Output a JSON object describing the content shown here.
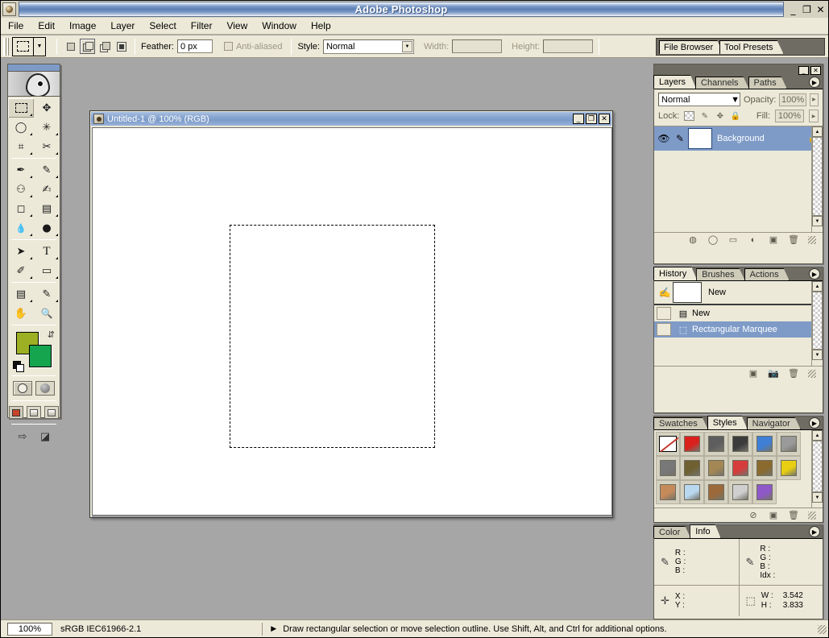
{
  "window": {
    "title": "Adobe Photoshop",
    "controls": {
      "minimize": "_",
      "maximize": "❐",
      "close": "✕"
    }
  },
  "menubar": {
    "items": [
      {
        "label": "File"
      },
      {
        "label": "Edit"
      },
      {
        "label": "Image"
      },
      {
        "label": "Layer"
      },
      {
        "label": "Select"
      },
      {
        "label": "Filter"
      },
      {
        "label": "View"
      },
      {
        "label": "Window"
      },
      {
        "label": "Help"
      }
    ]
  },
  "options_bar": {
    "tool": "rectangular-marquee",
    "selection_modes": [
      "new-selection",
      "add-to-selection",
      "subtract-from-selection",
      "intersect-with-selection"
    ],
    "active_selection_mode_index": 1,
    "feather_label": "Feather:",
    "feather_value": "0 px",
    "antialias_label": "Anti-aliased",
    "antialias_checked": false,
    "style_label": "Style:",
    "style_value": "Normal",
    "width_label": "Width:",
    "width_value": "",
    "height_label": "Height:",
    "height_value": "",
    "palette_well": [
      {
        "label": "File Browser"
      },
      {
        "label": "Tool Presets"
      }
    ]
  },
  "toolbox": {
    "foreground_color": "#9db023",
    "background_color": "#15a54f",
    "selected_tool": "rectangular-marquee",
    "tools": [
      {
        "name": "rectangular-marquee",
        "glyph": "",
        "selected": true
      },
      {
        "name": "move",
        "glyph": "✥"
      },
      {
        "name": "lasso",
        "glyph": "◯"
      },
      {
        "name": "magic-wand",
        "glyph": "✳"
      },
      {
        "name": "crop",
        "glyph": "⌗"
      },
      {
        "name": "slice",
        "glyph": "✂"
      },
      {
        "name": "healing-brush",
        "glyph": "✒"
      },
      {
        "name": "brush",
        "glyph": "✎"
      },
      {
        "name": "clone-stamp",
        "glyph": "⚇"
      },
      {
        "name": "history-brush",
        "glyph": "✍"
      },
      {
        "name": "eraser",
        "glyph": "◻"
      },
      {
        "name": "gradient",
        "glyph": "▤"
      },
      {
        "name": "blur",
        "glyph": "💧"
      },
      {
        "name": "dodge",
        "glyph": "●"
      },
      {
        "name": "path-selection",
        "glyph": "➤"
      },
      {
        "name": "type",
        "glyph": "T"
      },
      {
        "name": "pen",
        "glyph": "✐"
      },
      {
        "name": "rectangle-shape",
        "glyph": "▭"
      },
      {
        "name": "notes",
        "glyph": "▤"
      },
      {
        "name": "eyedropper",
        "glyph": "✎"
      },
      {
        "name": "hand",
        "glyph": "✋"
      },
      {
        "name": "zoom",
        "glyph": "🔍"
      }
    ],
    "screen_modes": [
      "standard-screen-mode",
      "full-screen-with-menu-bar",
      "full-screen-mode"
    ],
    "active_screen_mode_index": 0,
    "mask_modes": [
      "standard-mask-mode",
      "quick-mask-mode"
    ],
    "jump_to": [
      "jump-to-imageready",
      "preview-in-browser"
    ]
  },
  "document": {
    "title": "Untitled-1 @ 100% (RGB)",
    "controls": {
      "minimize": "_",
      "maximize": "❐",
      "close": "✕"
    },
    "selection": {
      "type": "rectangular-marquee",
      "visible": true
    }
  },
  "layers_panel": {
    "tabs": [
      {
        "label": "Layers",
        "active": true
      },
      {
        "label": "Channels",
        "active": false
      },
      {
        "label": "Paths",
        "active": false
      }
    ],
    "blend_mode": "Normal",
    "opacity_label": "Opacity:",
    "opacity_value": "100%",
    "lock_label": "Lock:",
    "lock_icons": [
      "lock-transparent-pixels",
      "lock-image-pixels",
      "lock-position",
      "lock-all"
    ],
    "fill_label": "Fill:",
    "fill_value": "100%",
    "layers": [
      {
        "name": "Background",
        "visible": true,
        "locked": true,
        "selected": true
      }
    ],
    "footer_icons": [
      "layer-style",
      "layer-mask",
      "layer-group",
      "adjustment-layer",
      "new-layer",
      "delete-layer"
    ]
  },
  "history_panel": {
    "tabs": [
      {
        "label": "History",
        "active": true
      },
      {
        "label": "Brushes",
        "active": false
      },
      {
        "label": "Actions",
        "active": false
      }
    ],
    "snapshot": {
      "label": "New"
    },
    "states": [
      {
        "label": "New",
        "icon": "new-document-icon",
        "selected": false
      },
      {
        "label": "Rectangular Marquee",
        "icon": "marquee-icon",
        "selected": true
      }
    ],
    "footer_icons": [
      "create-document-from-state",
      "create-new-snapshot",
      "delete-state"
    ]
  },
  "styles_panel": {
    "tabs": [
      {
        "label": "Swatches",
        "active": false
      },
      {
        "label": "Styles",
        "active": true
      },
      {
        "label": "Navigator",
        "active": false
      }
    ],
    "styles": [
      {
        "name": "default-none",
        "color": "none"
      },
      {
        "name": "sunspot",
        "color": "#d9201c"
      },
      {
        "name": "gray-button",
        "color": "#5e5e5e"
      },
      {
        "name": "dark-metal",
        "color": "#3b3b3b"
      },
      {
        "name": "blue-glass",
        "color": "#3f7fd6"
      },
      {
        "name": "flat-gray",
        "color": "#9a9a9a"
      },
      {
        "name": "gray-gradient",
        "color": "#787878"
      },
      {
        "name": "olive-brown",
        "color": "#6f6032"
      },
      {
        "name": "tan-texture",
        "color": "#a38754"
      },
      {
        "name": "red-stripes",
        "color": "#d63c3c"
      },
      {
        "name": "rainbow-swirl",
        "color": "#8a6a2d"
      },
      {
        "name": "yellow-gold",
        "color": "#e8cf12"
      },
      {
        "name": "sunset-gradient",
        "color": "#c58a5a"
      },
      {
        "name": "light-blue",
        "color": "#b9d8f0"
      },
      {
        "name": "beach-scene",
        "color": "#9c6a3a"
      },
      {
        "name": "noise-texture",
        "color": "#cfcfcf"
      },
      {
        "name": "purple-gradient",
        "color": "#8e58c8"
      }
    ],
    "footer_icons": [
      "clear-style",
      "new-style",
      "delete-style"
    ]
  },
  "info_panel": {
    "tabs": [
      {
        "label": "Color",
        "active": false
      },
      {
        "label": "Info",
        "active": true
      }
    ],
    "readout_left": {
      "keys": [
        "R :",
        "G :",
        "B :"
      ],
      "values": [
        "",
        "",
        ""
      ]
    },
    "readout_right": {
      "keys": [
        "R :",
        "G :",
        "B :",
        "Idx :"
      ],
      "values": [
        "",
        "",
        "",
        ""
      ]
    },
    "position": {
      "keys": [
        "X :",
        "Y :"
      ],
      "values": [
        "",
        ""
      ]
    },
    "dimensions": {
      "keys": [
        "W :",
        "H :"
      ],
      "values": [
        "3.542",
        "3.833"
      ]
    }
  },
  "statusbar": {
    "zoom": "100%",
    "doc_profile": "sRGB IEC61966-2.1",
    "hint": "Draw rectangular selection or move selection outline.  Use Shift, Alt, and Ctrl for additional options."
  }
}
